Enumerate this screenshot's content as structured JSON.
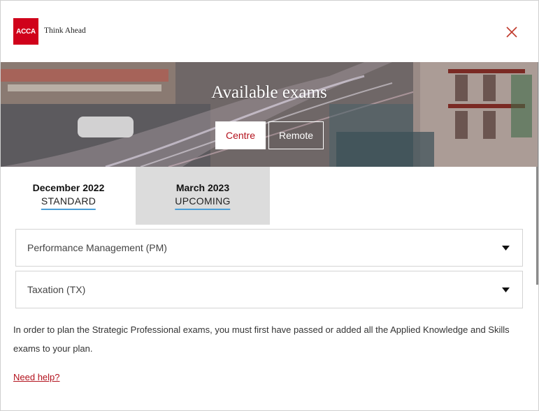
{
  "header": {
    "logo_text": "ACCA",
    "tagline": "Think Ahead",
    "close_icon": "close-icon",
    "brand_color": "#d0021b"
  },
  "hero": {
    "title": "Available exams",
    "modes": [
      {
        "label": "Centre",
        "selected": true
      },
      {
        "label": "Remote",
        "selected": false
      }
    ]
  },
  "tabs": [
    {
      "month": "December 2022",
      "status": "STANDARD",
      "active": false
    },
    {
      "month": "March 2023",
      "status": "UPCOMING",
      "active": true
    }
  ],
  "exams": [
    {
      "label": "Performance Management (PM)",
      "icon": "chevron-down-icon"
    },
    {
      "label": "Taxation (TX)",
      "icon": "chevron-down-icon"
    }
  ],
  "info_text": "In order to plan the Strategic Professional exams, you must first have passed or added all the Applied Knowledge and Skills exams to your plan.",
  "help_link": "Need help?",
  "colors": {
    "accent_red": "#b3121d",
    "tab_underline": "#4a9ed6",
    "active_tab_bg": "#dcdcdc"
  }
}
